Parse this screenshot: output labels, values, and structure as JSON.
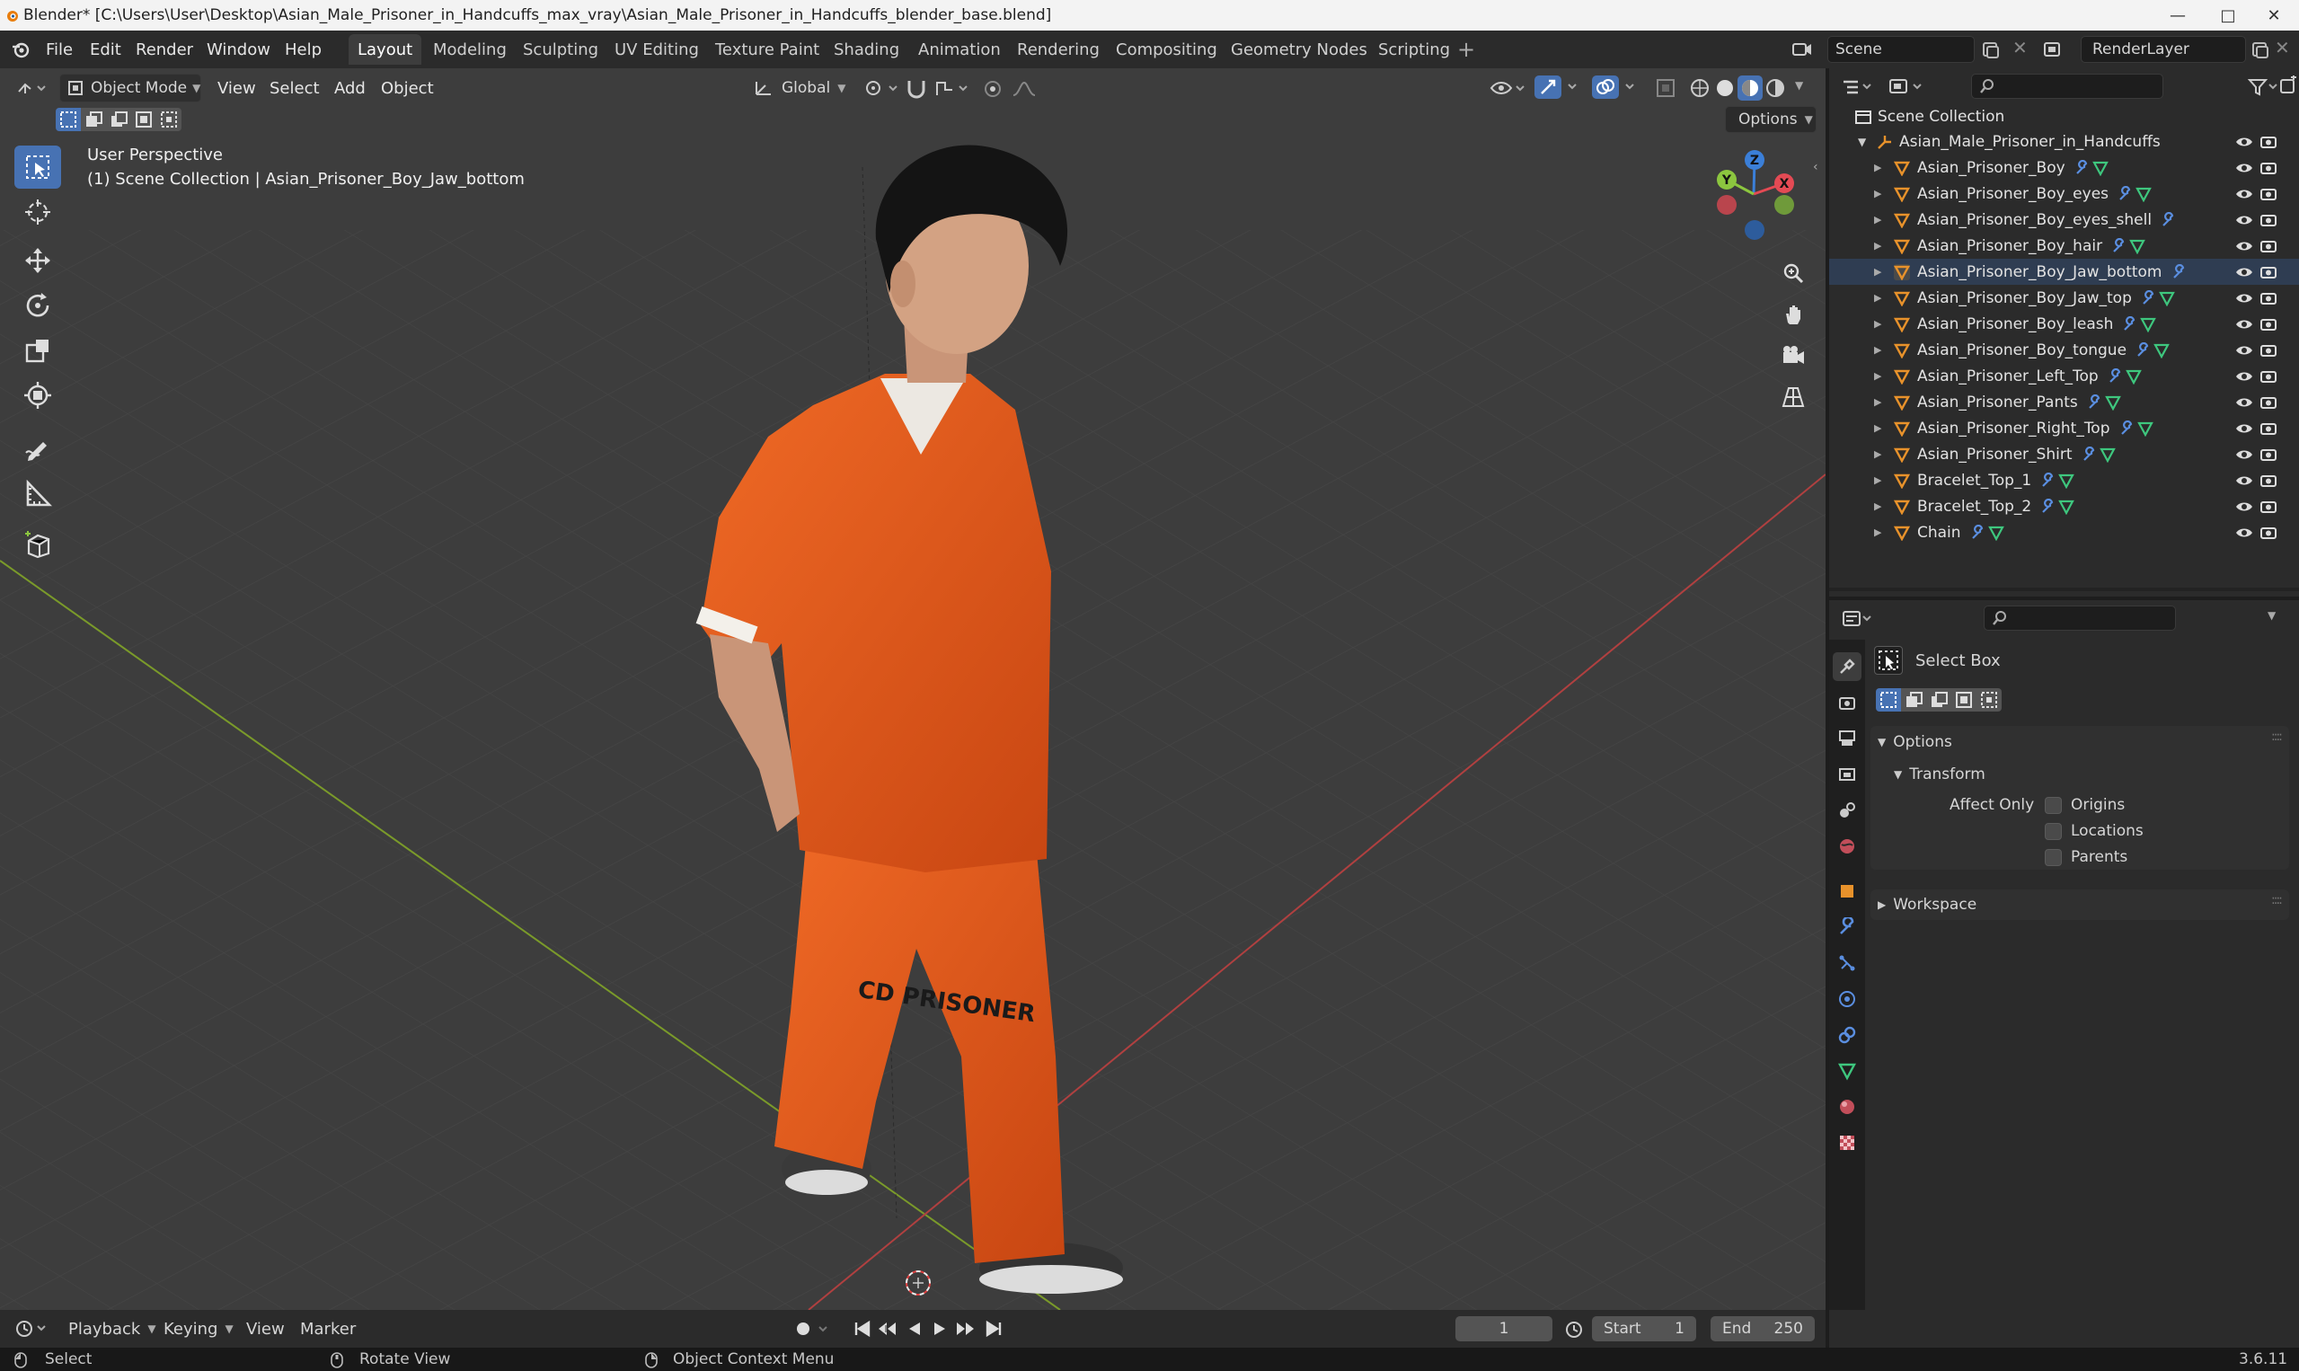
{
  "titlebar": {
    "title": "Blender* [C:\\Users\\User\\Desktop\\Asian_Male_Prisoner_in_Handcuffs_max_vray\\Asian_Male_Prisoner_in_Handcuffs_blender_base.blend]"
  },
  "menu": {
    "file": "File",
    "edit": "Edit",
    "render": "Render",
    "window": "Window",
    "help": "Help"
  },
  "workspaces": [
    "Layout",
    "Modeling",
    "Sculpting",
    "UV Editing",
    "Texture Paint",
    "Shading",
    "Animation",
    "Rendering",
    "Compositing",
    "Geometry Nodes",
    "Scripting"
  ],
  "active_workspace": "Layout",
  "scene": {
    "name": "Scene",
    "view_layer": "RenderLayer"
  },
  "viewport": {
    "mode": "Object Mode",
    "menus": [
      "View",
      "Select",
      "Add",
      "Object"
    ],
    "orientation": "Global",
    "options_label": "Options",
    "perspective": "User Perspective",
    "context": "(1) Scene Collection | Asian_Prisoner_Boy_Jaw_bottom",
    "gizmo_axes": {
      "x": "X",
      "y": "Y",
      "z": "Z"
    },
    "pants_text": "CD  PRISONER"
  },
  "outliner": {
    "root": "Scene Collection",
    "collection": "Asian_Male_Prisoner_in_Handcuffs",
    "items": [
      "Asian_Prisoner_Boy",
      "Asian_Prisoner_Boy_eyes",
      "Asian_Prisoner_Boy_eyes_shell",
      "Asian_Prisoner_Boy_hair",
      "Asian_Prisoner_Boy_Jaw_bottom",
      "Asian_Prisoner_Boy_Jaw_top",
      "Asian_Prisoner_Boy_leash",
      "Asian_Prisoner_Boy_tongue",
      "Asian_Prisoner_Left_Top",
      "Asian_Prisoner_Pants",
      "Asian_Prisoner_Right_Top",
      "Asian_Prisoner_Shirt",
      "Bracelet_Top_1",
      "Bracelet_Top_2",
      "Chain"
    ],
    "active_item": "Asian_Prisoner_Boy_Jaw_bottom"
  },
  "properties": {
    "tool_name": "Select Box",
    "options": "Options",
    "transform": "Transform",
    "affect_only": "Affect Only",
    "origins": "Origins",
    "locations": "Locations",
    "parents": "Parents",
    "workspace": "Workspace"
  },
  "timeline": {
    "menus": [
      "Playback",
      "Keying",
      "View",
      "Marker"
    ],
    "current_frame": "1",
    "start_label": "Start",
    "start": "1",
    "end_label": "End",
    "end": "250"
  },
  "status": {
    "select": "Select",
    "rotate": "Rotate View",
    "context_menu": "Object Context Menu",
    "version": "3.6.11"
  },
  "colors": {
    "accent": "#4772b3",
    "grid_x": "#b04040",
    "grid_y": "#7a9a2a",
    "jumpsuit": "#e0581c",
    "axis_x": "#e44a54",
    "axis_y": "#8cc63f",
    "axis_z": "#3b7fd8"
  }
}
